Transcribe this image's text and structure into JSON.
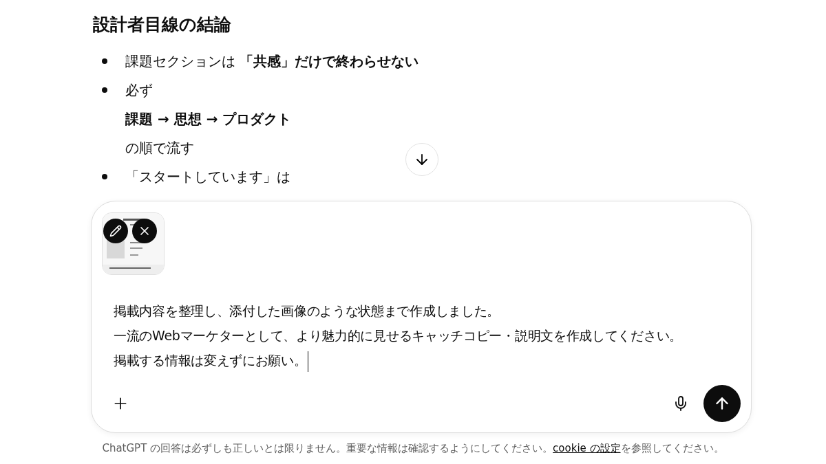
{
  "answer": {
    "heading": "設計者目線の結論",
    "bullets": [
      {
        "lines": [
          "課題セクションは **「共感」だけで終わらせない**"
        ]
      },
      {
        "lines": [
          "必ず",
          "**課題 → 思想 → プロダクト**",
          "の順で流す"
        ]
      },
      {
        "lines": [
          "「スタートしています」は"
        ]
      }
    ]
  },
  "composer": {
    "message_lines": [
      "掲載内容を整理し、添付した画像のような状態まで作成しました。",
      "一流のWebマーケターとして、より魅力的に見せるキャッチコピー・説明文を作成してください。",
      "掲載する情報は変えずにお願い。"
    ]
  },
  "footer": {
    "before": "ChatGPT の回答は必ずしも正しいとは限りません。重要な情報は確認するようにしてください。",
    "link": "cookie の設定",
    "after": "を参照してください。"
  }
}
